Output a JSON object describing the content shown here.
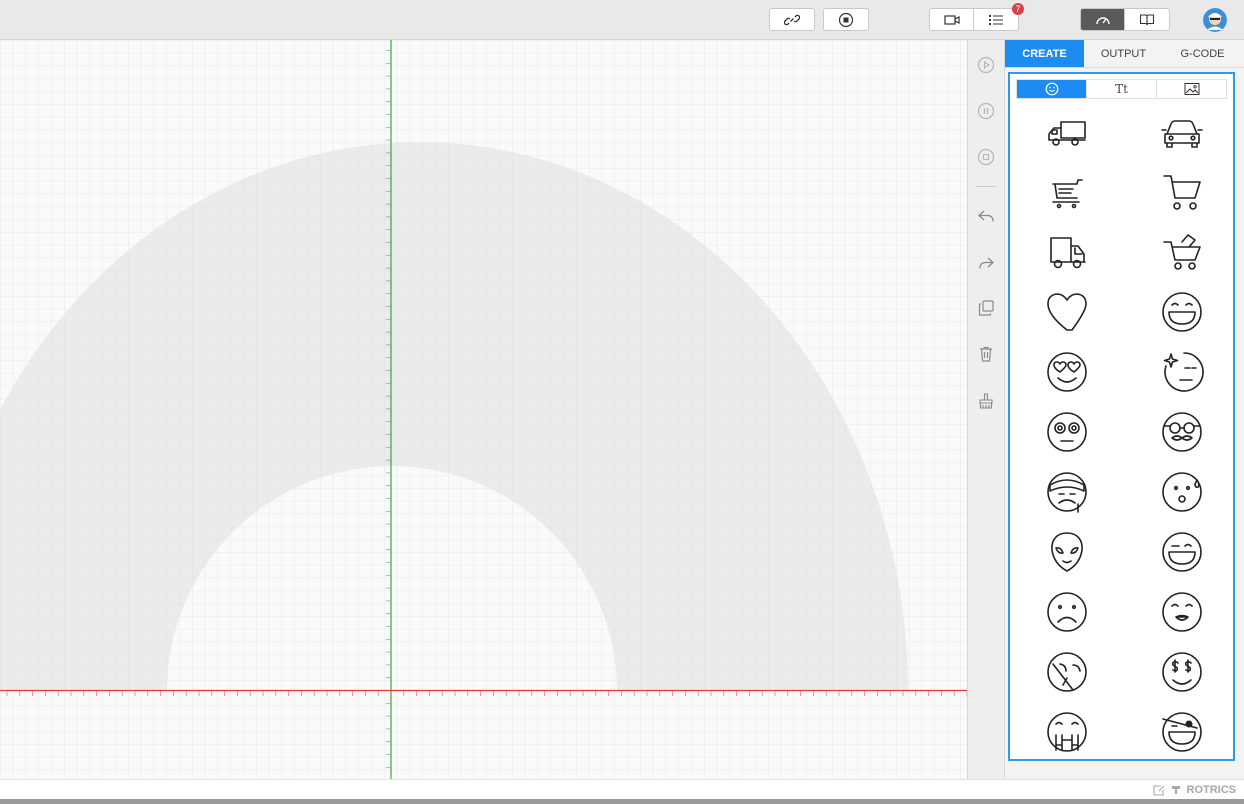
{
  "topbar": {
    "badge_count": "7",
    "buttons": [
      "link-icon",
      "stop-icon",
      "camera-icon",
      "list-icon",
      "speedometer-icon",
      "book-icon"
    ]
  },
  "panel": {
    "tabs": [
      "CREATE",
      "OUTPUT",
      "G-CODE"
    ],
    "active_tab": "CREATE",
    "subtabs": [
      "smiley-icon",
      "Tt",
      "image-icon"
    ]
  },
  "icons": [
    "truck-icon",
    "car-icon",
    "cart-list-icon",
    "shopping-cart-icon",
    "delivery-van-icon",
    "cart-with-box-icon",
    "heart-icon",
    "grin-icon",
    "heart-eyes-icon",
    "sparkle-face-icon",
    "dizzy-face-icon",
    "nerd-mustache-icon",
    "bandage-face-icon",
    "surprised-sweat-icon",
    "alien-icon",
    "wink-icon",
    "sad-face-icon",
    "kissing-face-icon",
    "crying-tear-icon",
    "money-eyes-icon",
    "grinning-hands-icon",
    "pirate-face-icon"
  ],
  "statusbar": {
    "brand": "ROTRICS"
  },
  "colors": {
    "accent": "#1c8cf0",
    "x_axis": "#e53935",
    "y_axis": "#43a047"
  }
}
